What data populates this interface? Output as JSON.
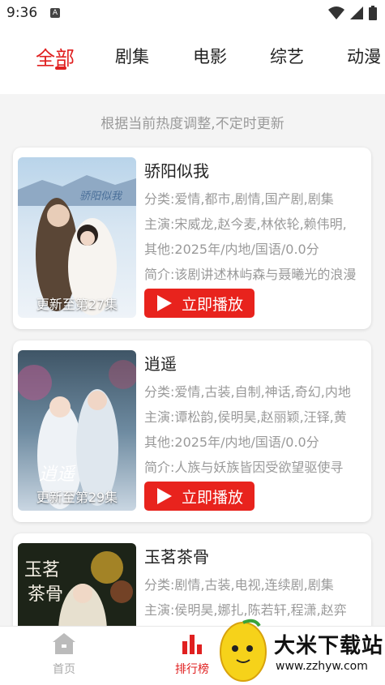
{
  "status": {
    "time": "9:36",
    "notification": "A"
  },
  "tabs": [
    {
      "label": "全部",
      "active": true
    },
    {
      "label": "剧集",
      "active": false
    },
    {
      "label": "电影",
      "active": false
    },
    {
      "label": "综艺",
      "active": false
    },
    {
      "label": "动漫",
      "active": false
    }
  ],
  "hint": "根据当前热度调整,不定时更新",
  "cards": [
    {
      "title": "骄阳似我",
      "category": "分类:爱情,都市,剧情,国产剧,剧集",
      "cast": "主演:宋威龙,赵今麦,林依轮,赖伟明,",
      "other": "其他:2025年/内地/国语/0.0分",
      "intro": "简介:该剧讲述林屿森与聂曦光的浪漫",
      "update": "更新至第27集",
      "play": "立即播放"
    },
    {
      "title": "逍遥",
      "category": "分类:爱情,古装,自制,神话,奇幻,内地",
      "cast": "主演:谭松韵,侯明昊,赵丽颖,汪铎,黄",
      "other": "其他:2025年/内地/国语/0.0分",
      "intro": "简介:人族与妖族皆因受欲望驱使寻",
      "update": "更新至第29集",
      "play": "立即播放"
    },
    {
      "title": "玉茗茶骨",
      "category": "分类:剧情,古装,电视,连续剧,剧集",
      "cast": "主演:侯明昊,娜扎,陈若轩,程潇,赵弈"
    }
  ],
  "nav": {
    "home": "首页",
    "rank": "排行榜"
  },
  "watermark": {
    "name": "大米下载站",
    "url": "www.zzhyw.com"
  },
  "colors": {
    "accent": "#e02020",
    "play_button": "#e8231d",
    "hint": "#9a9a9a"
  }
}
